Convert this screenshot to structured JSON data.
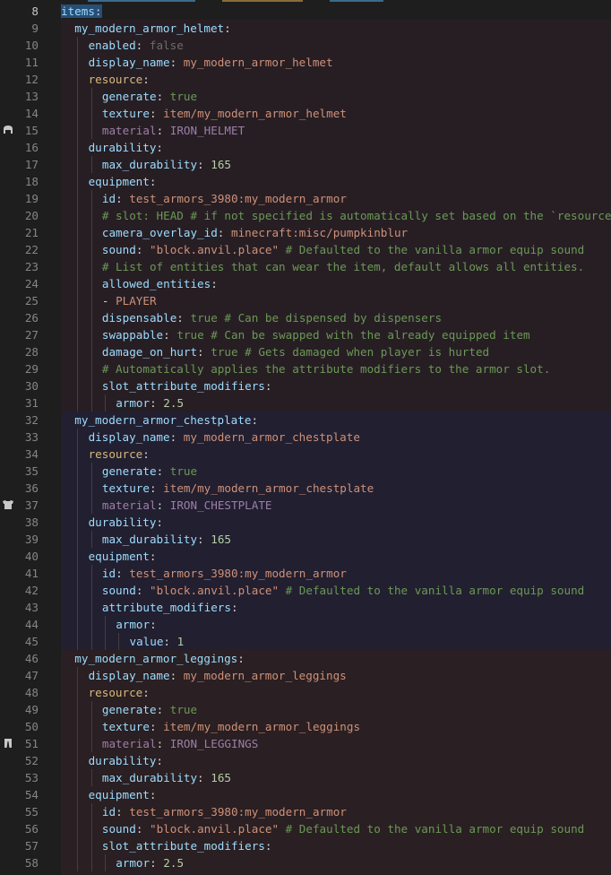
{
  "colors": {
    "background": "#1e1e1e",
    "gutter_text": "#858585",
    "gutter_text_active": "#c6c6c6",
    "key": "#9cdcfe",
    "key_yellow": "#d7ba7d",
    "string": "#ce9178",
    "number": "#b5cea8",
    "bool": "#6a9955",
    "bool_disabled": "#6b6b6b",
    "material": "#9c7fa8",
    "comment": "#6a9955",
    "selection": "#264f78",
    "helmet_region": "#2a1f24",
    "chestplate_region": "#221f30",
    "leggings_region": "#2a1f22"
  },
  "gutter_icons": [
    {
      "line": 15,
      "icon": "iron-helmet-icon"
    },
    {
      "line": 37,
      "icon": "iron-chestplate-icon"
    },
    {
      "line": 51,
      "icon": "iron-leggings-icon"
    }
  ],
  "lines": [
    {
      "n": "8",
      "indent": 0,
      "key": "items",
      "colon": ":",
      "sel": true
    },
    {
      "n": "9",
      "indent": 1,
      "key": "my_modern_armor_helmet",
      "colon": ":"
    },
    {
      "n": "10",
      "indent": 2,
      "key": "enabled",
      "colon": ":",
      "value": "false",
      "vtype": "dim2"
    },
    {
      "n": "11",
      "indent": 2,
      "key": "display_name",
      "colon": ":",
      "value": "my_modern_armor_helmet",
      "vtype": "str"
    },
    {
      "n": "12",
      "indent": 2,
      "key": "resource",
      "colon": ":",
      "kcls": "yellow"
    },
    {
      "n": "13",
      "indent": 3,
      "key": "generate",
      "colon": ":",
      "value": "true",
      "vtype": "gbool"
    },
    {
      "n": "14",
      "indent": 3,
      "key": "texture",
      "colon": ":",
      "value": "item/my_modern_armor_helmet",
      "vtype": "str"
    },
    {
      "n": "15",
      "indent": 3,
      "key": "material",
      "colon": ":",
      "value": "IRON_HELMET",
      "vtype": "dim",
      "kcls": "dim"
    },
    {
      "n": "16",
      "indent": 2,
      "key": "durability",
      "colon": ":"
    },
    {
      "n": "17",
      "indent": 3,
      "key": "max_durability",
      "colon": ":",
      "value": "165",
      "vtype": "num"
    },
    {
      "n": "18",
      "indent": 2,
      "key": "equipment",
      "colon": ":"
    },
    {
      "n": "19",
      "indent": 3,
      "key": "id",
      "colon": ":",
      "value": "test_armors_3980:my_modern_armor",
      "vtype": "str"
    },
    {
      "n": "20",
      "indent": 3,
      "comment": "# slot: HEAD # if not specified is automatically set based on the `resource"
    },
    {
      "n": "21",
      "indent": 3,
      "key": "camera_overlay_id",
      "colon": ":",
      "value": "minecraft:misc/pumpkinblur",
      "vtype": "str"
    },
    {
      "n": "22",
      "indent": 3,
      "key": "sound",
      "colon": ":",
      "value": "\"block.anvil.place\"",
      "vtype": "str",
      "trail": " # Defaulted to the vanilla armor equip sound"
    },
    {
      "n": "23",
      "indent": 3,
      "comment": "# List of entities that can wear the item, default allows all entities."
    },
    {
      "n": "24",
      "indent": 3,
      "key": "allowed_entities",
      "colon": ":"
    },
    {
      "n": "25",
      "indent": 3,
      "dash": "- ",
      "value": "PLAYER",
      "vtype": "str"
    },
    {
      "n": "26",
      "indent": 3,
      "key": "dispensable",
      "colon": ":",
      "value": "true",
      "vtype": "gbool",
      "trail": " # Can be dispensed by dispensers"
    },
    {
      "n": "27",
      "indent": 3,
      "key": "swappable",
      "colon": ":",
      "value": "true",
      "vtype": "gbool",
      "trail": " # Can be swapped with the already equipped item"
    },
    {
      "n": "28",
      "indent": 3,
      "key": "damage_on_hurt",
      "colon": ":",
      "value": "true",
      "vtype": "gbool",
      "trail": " # Gets damaged when player is hurted"
    },
    {
      "n": "29",
      "indent": 3,
      "comment": "# Automatically applies the attribute modifiers to the armor slot."
    },
    {
      "n": "30",
      "indent": 3,
      "key": "slot_attribute_modifiers",
      "colon": ":"
    },
    {
      "n": "31",
      "indent": 4,
      "key": "armor",
      "colon": ":",
      "value": "2.5",
      "vtype": "num"
    },
    {
      "n": "32",
      "indent": 1,
      "key": "my_modern_armor_chestplate",
      "colon": ":"
    },
    {
      "n": "33",
      "indent": 2,
      "key": "display_name",
      "colon": ":",
      "value": "my_modern_armor_chestplate",
      "vtype": "str"
    },
    {
      "n": "34",
      "indent": 2,
      "key": "resource",
      "colon": ":",
      "kcls": "yellow"
    },
    {
      "n": "35",
      "indent": 3,
      "key": "generate",
      "colon": ":",
      "value": "true",
      "vtype": "gbool"
    },
    {
      "n": "36",
      "indent": 3,
      "key": "texture",
      "colon": ":",
      "value": "item/my_modern_armor_chestplate",
      "vtype": "str"
    },
    {
      "n": "37",
      "indent": 3,
      "key": "material",
      "colon": ":",
      "value": "IRON_CHESTPLATE",
      "vtype": "dim",
      "kcls": "dim"
    },
    {
      "n": "38",
      "indent": 2,
      "key": "durability",
      "colon": ":"
    },
    {
      "n": "39",
      "indent": 3,
      "key": "max_durability",
      "colon": ":",
      "value": "165",
      "vtype": "num"
    },
    {
      "n": "40",
      "indent": 2,
      "key": "equipment",
      "colon": ":"
    },
    {
      "n": "41",
      "indent": 3,
      "key": "id",
      "colon": ":",
      "value": "test_armors_3980:my_modern_armor",
      "vtype": "str"
    },
    {
      "n": "42",
      "indent": 3,
      "key": "sound",
      "colon": ":",
      "value": "\"block.anvil.place\"",
      "vtype": "str",
      "trail": " # Defaulted to the vanilla armor equip sound"
    },
    {
      "n": "43",
      "indent": 3,
      "key": "attribute_modifiers",
      "colon": ":"
    },
    {
      "n": "44",
      "indent": 4,
      "key": "armor",
      "colon": ":"
    },
    {
      "n": "45",
      "indent": 5,
      "key": "value",
      "colon": ":",
      "value": "1",
      "vtype": "num"
    },
    {
      "n": "46",
      "indent": 1,
      "key": "my_modern_armor_leggings",
      "colon": ":"
    },
    {
      "n": "47",
      "indent": 2,
      "key": "display_name",
      "colon": ":",
      "value": "my_modern_armor_leggings",
      "vtype": "str"
    },
    {
      "n": "48",
      "indent": 2,
      "key": "resource",
      "colon": ":",
      "kcls": "yellow"
    },
    {
      "n": "49",
      "indent": 3,
      "key": "generate",
      "colon": ":",
      "value": "true",
      "vtype": "gbool"
    },
    {
      "n": "50",
      "indent": 3,
      "key": "texture",
      "colon": ":",
      "value": "item/my_modern_armor_leggings",
      "vtype": "str"
    },
    {
      "n": "51",
      "indent": 3,
      "key": "material",
      "colon": ":",
      "value": "IRON_LEGGINGS",
      "vtype": "dim",
      "kcls": "dim"
    },
    {
      "n": "52",
      "indent": 2,
      "key": "durability",
      "colon": ":"
    },
    {
      "n": "53",
      "indent": 3,
      "key": "max_durability",
      "colon": ":",
      "value": "165",
      "vtype": "num"
    },
    {
      "n": "54",
      "indent": 2,
      "key": "equipment",
      "colon": ":"
    },
    {
      "n": "55",
      "indent": 3,
      "key": "id",
      "colon": ":",
      "value": "test_armors_3980:my_modern_armor",
      "vtype": "str"
    },
    {
      "n": "56",
      "indent": 3,
      "key": "sound",
      "colon": ":",
      "value": "\"block.anvil.place\"",
      "vtype": "str",
      "trail": " # Defaulted to the vanilla armor equip sound"
    },
    {
      "n": "57",
      "indent": 3,
      "key": "slot_attribute_modifiers",
      "colon": ":"
    },
    {
      "n": "58",
      "indent": 4,
      "key": "armor",
      "colon": ":",
      "value": "2.5",
      "vtype": "num"
    }
  ]
}
